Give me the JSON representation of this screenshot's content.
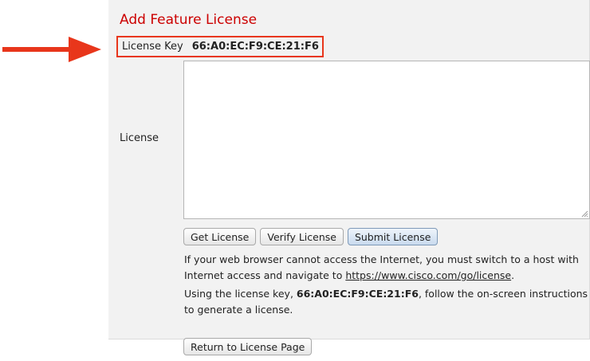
{
  "page": {
    "title": "Add Feature License"
  },
  "license_key": {
    "label": "License Key",
    "value": "66:A0:EC:F9:CE:21:F6"
  },
  "license": {
    "label": "License",
    "value": ""
  },
  "buttons": {
    "get_license": "Get License",
    "verify_license": "Verify License",
    "submit_license": "Submit License",
    "return": "Return to License Page"
  },
  "info": {
    "p1_before": "If your web browser cannot access the Internet, you must switch to a host with Internet access and navigate to ",
    "link": "https://www.cisco.com/go/license",
    "p1_after": ".",
    "p2_before": "Using the license key, ",
    "key_value": "66:A0:EC:F9:CE:21:F6",
    "p2_after": ", follow the on-screen instructions to generate a license."
  },
  "annotation": {
    "arrow_color": "#e8361b",
    "highlight_color": "#e8361b"
  },
  "colors": {
    "title": "#cc0000",
    "panel_bg": "#f2f2f2"
  }
}
